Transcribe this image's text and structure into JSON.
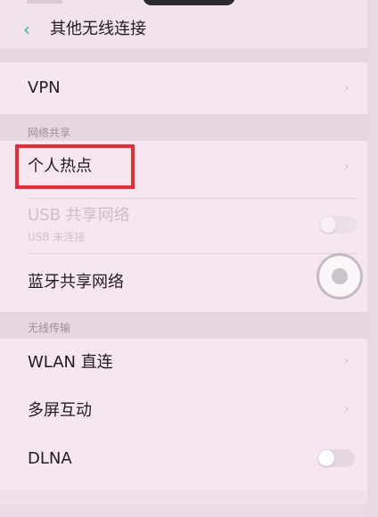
{
  "header": {
    "back_icon": "chevron-left-icon",
    "title": "其他无线连接"
  },
  "vpn": {
    "label": "VPN"
  },
  "network_sharing": {
    "section_title": "网络共享",
    "hotspot_label": "个人热点",
    "usb_label": "USB 共享网络",
    "usb_status": "USB 未连接",
    "bluetooth_label": "蓝牙共享网络"
  },
  "wireless_transfer": {
    "section_title": "无线传输",
    "wlan_direct_label": "WLAN 直连",
    "multiscreen_label": "多屏互动",
    "dlna_label": "DLNA"
  },
  "colors": {
    "accent": "#27b0a3",
    "highlight_box": "#ea2b35",
    "background": "#f1e2ec"
  }
}
